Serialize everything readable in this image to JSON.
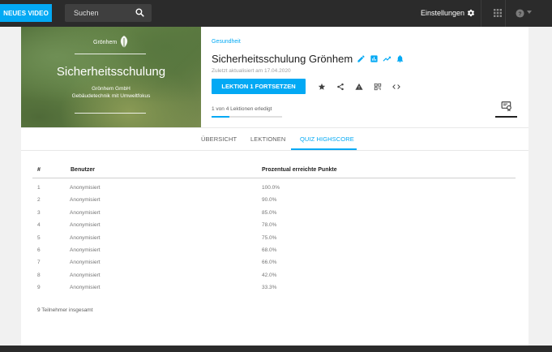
{
  "topbar": {
    "new_video_label": "NEUES VIDEO",
    "search_placeholder": "Suchen",
    "settings_label": "Einstellungen"
  },
  "course": {
    "thumbnail": {
      "logo_text": "Grönhem",
      "title": "Sicherheitsschulung",
      "subtitle_line1": "Grönhem GmbH",
      "subtitle_line2": "Gebäudetechnik mit Umweltfokus"
    },
    "category": "Gesundheit",
    "title": "Sicherheitsschulung Grönhem",
    "updated": "Zuletzt aktualisiert am 17.04.2020",
    "continue_label": "LEKTION 1 FORTSETZEN",
    "progress_text": "1 von 4 Lektionen erledigt",
    "progress_fraction": 0.25
  },
  "tabs": [
    {
      "label": "ÜBERSICHT",
      "active": false
    },
    {
      "label": "LEKTIONEN",
      "active": false
    },
    {
      "label": "QUIZ HIGHSCORE",
      "active": true
    }
  ],
  "table": {
    "headers": [
      "#",
      "Benutzer",
      "Prozentual erreichte Punkte"
    ],
    "rows": [
      [
        "1",
        "Anonymisiert",
        "100.0%"
      ],
      [
        "2",
        "Anonymisiert",
        "90.0%"
      ],
      [
        "3",
        "Anonymisiert",
        "85.0%"
      ],
      [
        "4",
        "Anonymisiert",
        "78.0%"
      ],
      [
        "5",
        "Anonymisiert",
        "75.0%"
      ],
      [
        "6",
        "Anonymisiert",
        "68.0%"
      ],
      [
        "7",
        "Anonymisiert",
        "66.0%"
      ],
      [
        "8",
        "Anonymisiert",
        "42.0%"
      ],
      [
        "9",
        "Anonymisiert",
        "33.3%"
      ]
    ],
    "footer": "9 Teilnehmer insgesamt"
  },
  "colors": {
    "accent": "#03a9f4",
    "topbar": "#2b2b2b"
  },
  "icons": [
    "search-icon",
    "gear-icon",
    "apps-grid-icon",
    "help-icon",
    "pencil-icon",
    "bar-chart-icon",
    "trending-up-icon",
    "bell-icon",
    "star-icon",
    "share-icon",
    "warning-icon",
    "qr-code-icon",
    "embed-code-icon",
    "certificate-icon"
  ]
}
